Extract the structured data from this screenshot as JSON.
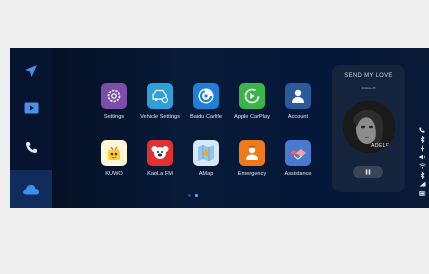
{
  "sidebar": {
    "items": [
      {
        "icon": "navigation-icon"
      },
      {
        "icon": "video-icon"
      },
      {
        "icon": "phone-icon"
      },
      {
        "icon": "cloud-icon",
        "active": true
      }
    ]
  },
  "apps": [
    {
      "label": "Settings",
      "icon": "settings-icon",
      "color": "#7b4fa8"
    },
    {
      "label": "Vehicle Settings",
      "icon": "vehicle-settings-icon",
      "color": "#2ea0d8"
    },
    {
      "label": "Baidu Carlife",
      "icon": "baidu-carlife-icon",
      "color": "#1e7fd8"
    },
    {
      "label": "Apple CarPlay",
      "icon": "apple-carplay-icon",
      "color": "#3bb54a"
    },
    {
      "label": "Account",
      "icon": "account-icon",
      "color": "#2a5a9a"
    },
    {
      "label": "KUWO",
      "icon": "kuwo-icon",
      "color": "#ffffff"
    },
    {
      "label": "KaoLa FM",
      "icon": "kaola-fm-icon",
      "color": "#e03030"
    },
    {
      "label": "AMap",
      "icon": "amap-icon",
      "color": "#d9e7f5"
    },
    {
      "label": "Emergency",
      "icon": "emergency-icon",
      "color": "#f07a1a"
    },
    {
      "label": "Assistance",
      "icon": "assistance-icon",
      "color": "#4a7ad0"
    }
  ],
  "pagination": {
    "pages": 2,
    "current": 2
  },
  "music": {
    "title": "SEND MY LOVE",
    "artist": "ADELE-25",
    "album_text": "ADELE",
    "pause_icon": "pause-icon"
  },
  "status_icons": [
    "phone-status-icon",
    "bluetooth-icon",
    "usb-icon",
    "volume-icon",
    "wifi-icon",
    "bluetooth-icon",
    "signal-icon",
    "battery-icon"
  ]
}
